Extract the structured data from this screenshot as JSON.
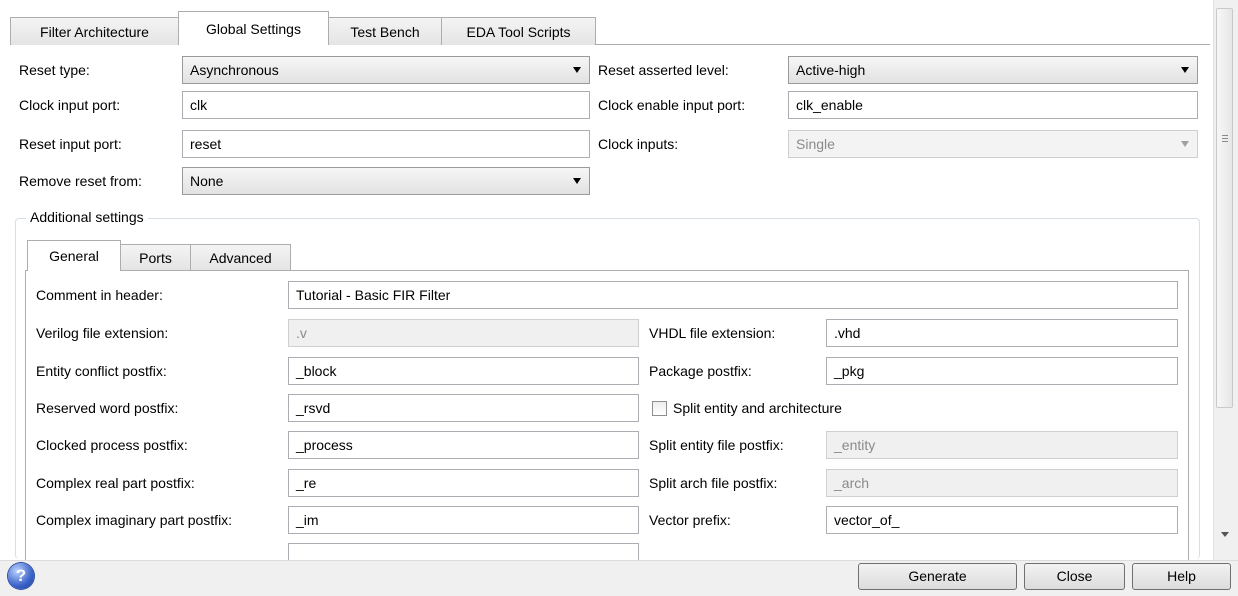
{
  "tabs": [
    "Filter Architecture",
    "Global Settings",
    "Test Bench",
    "EDA Tool Scripts"
  ],
  "active_tab": "Global Settings",
  "global": {
    "reset_type_label": "Reset type:",
    "reset_type_value": "Asynchronous",
    "reset_level_label": "Reset asserted level:",
    "reset_level_value": "Active-high",
    "clock_port_label": "Clock input port:",
    "clock_port_value": "clk",
    "clock_enable_label": "Clock enable input port:",
    "clock_enable_value": "clk_enable",
    "reset_port_label": "Reset input port:",
    "reset_port_value": "reset",
    "clock_inputs_label": "Clock inputs:",
    "clock_inputs_value": "Single",
    "remove_reset_label": "Remove reset from:",
    "remove_reset_value": "None"
  },
  "additional": {
    "title": "Additional settings",
    "tabs": [
      "General",
      "Ports",
      "Advanced"
    ],
    "active_tab": "General",
    "comment_label": "Comment in header:",
    "comment_value": "Tutorial - Basic FIR Filter",
    "verilog_ext_label": "Verilog file extension:",
    "verilog_ext_value": ".v",
    "vhdl_ext_label": "VHDL file extension:",
    "vhdl_ext_value": ".vhd",
    "entity_conflict_label": "Entity conflict postfix:",
    "entity_conflict_value": "_block",
    "package_postfix_label": "Package postfix:",
    "package_postfix_value": "_pkg",
    "reserved_word_label": "Reserved word postfix:",
    "reserved_word_value": "_rsvd",
    "split_entity_label": "Split entity and architecture",
    "split_entity_checked": false,
    "clocked_process_label": "Clocked process postfix:",
    "clocked_process_value": "_process",
    "split_entity_file_label": "Split entity file postfix:",
    "split_entity_file_value": "_entity",
    "complex_real_label": "Complex real part postfix:",
    "complex_real_value": "_re",
    "split_arch_label": "Split arch file postfix:",
    "split_arch_value": "_arch",
    "complex_imag_label": "Complex imaginary part postfix:",
    "complex_imag_value": "_im",
    "vector_prefix_label": "Vector prefix:",
    "vector_prefix_value": "vector_of_"
  },
  "buttons": {
    "generate": "Generate",
    "close": "Close",
    "help": "Help"
  },
  "icons": {
    "help": "help-question-icon"
  }
}
